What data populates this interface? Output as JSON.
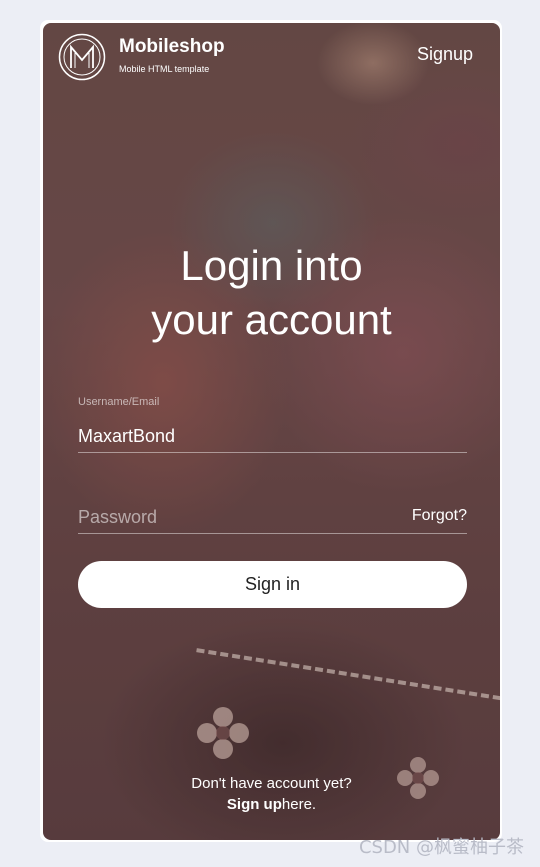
{
  "header": {
    "brand_title": "Mobileshop",
    "brand_subtitle": "Mobile HTML template",
    "signup_label": "Signup",
    "logo_icon": "monogram-m-logo-icon"
  },
  "main": {
    "heading_line1": "Login into",
    "heading_line2": "your account",
    "username_label": "Username/Email",
    "username_value": "MaxartBond",
    "password_placeholder": "Password",
    "forgot_label": "Forgot?",
    "signin_label": "Sign in"
  },
  "footer": {
    "prompt": "Don't have account yet?",
    "signup_bold": "Sign up",
    "signup_suffix": "here."
  },
  "watermark": "CSDN @枫蜜柚子茶",
  "colors": {
    "page_background": "#eceef5",
    "card_tint": "#6a4a48",
    "button_background": "#ffffff",
    "text_on_card": "#ffffff"
  }
}
